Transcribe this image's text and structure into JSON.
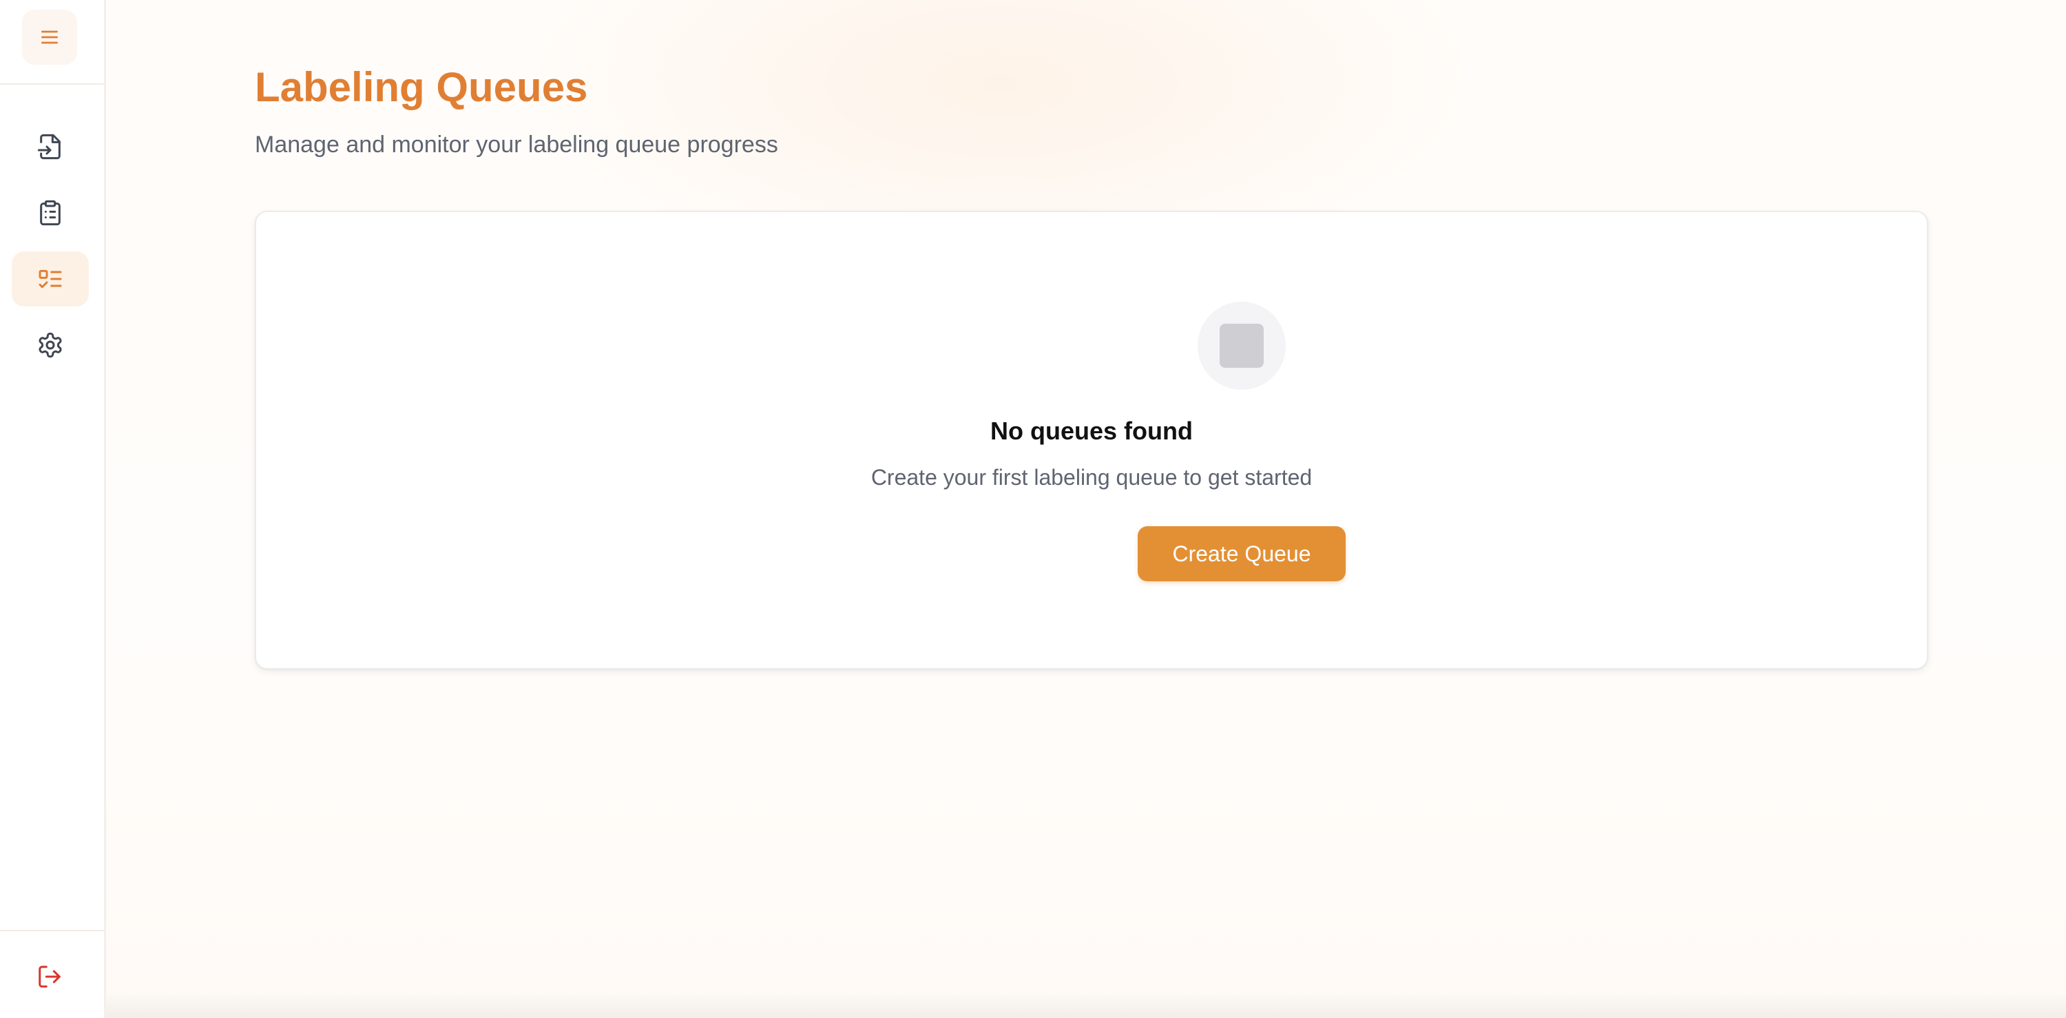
{
  "colors": {
    "accent": "#e07f33",
    "button": "#e39035",
    "logout": "#d9352b",
    "icon": "#3f4652"
  },
  "sidebar": {
    "menu_icon": "hamburger-menu-icon",
    "items": [
      {
        "name": "import",
        "icon": "file-import-icon"
      },
      {
        "name": "tasks",
        "icon": "clipboard-list-icon"
      },
      {
        "name": "labeling-queues",
        "icon": "list-checks-icon",
        "active": true
      },
      {
        "name": "settings",
        "icon": "gear-icon"
      }
    ],
    "logout_icon": "log-out-icon"
  },
  "header": {
    "title": "Labeling Queues",
    "subtitle": "Manage and monitor your labeling queue progress"
  },
  "empty_state": {
    "icon": "placeholder-square-icon",
    "title": "No queues found",
    "text": "Create your first labeling queue to get started",
    "button_label": "Create Queue"
  }
}
